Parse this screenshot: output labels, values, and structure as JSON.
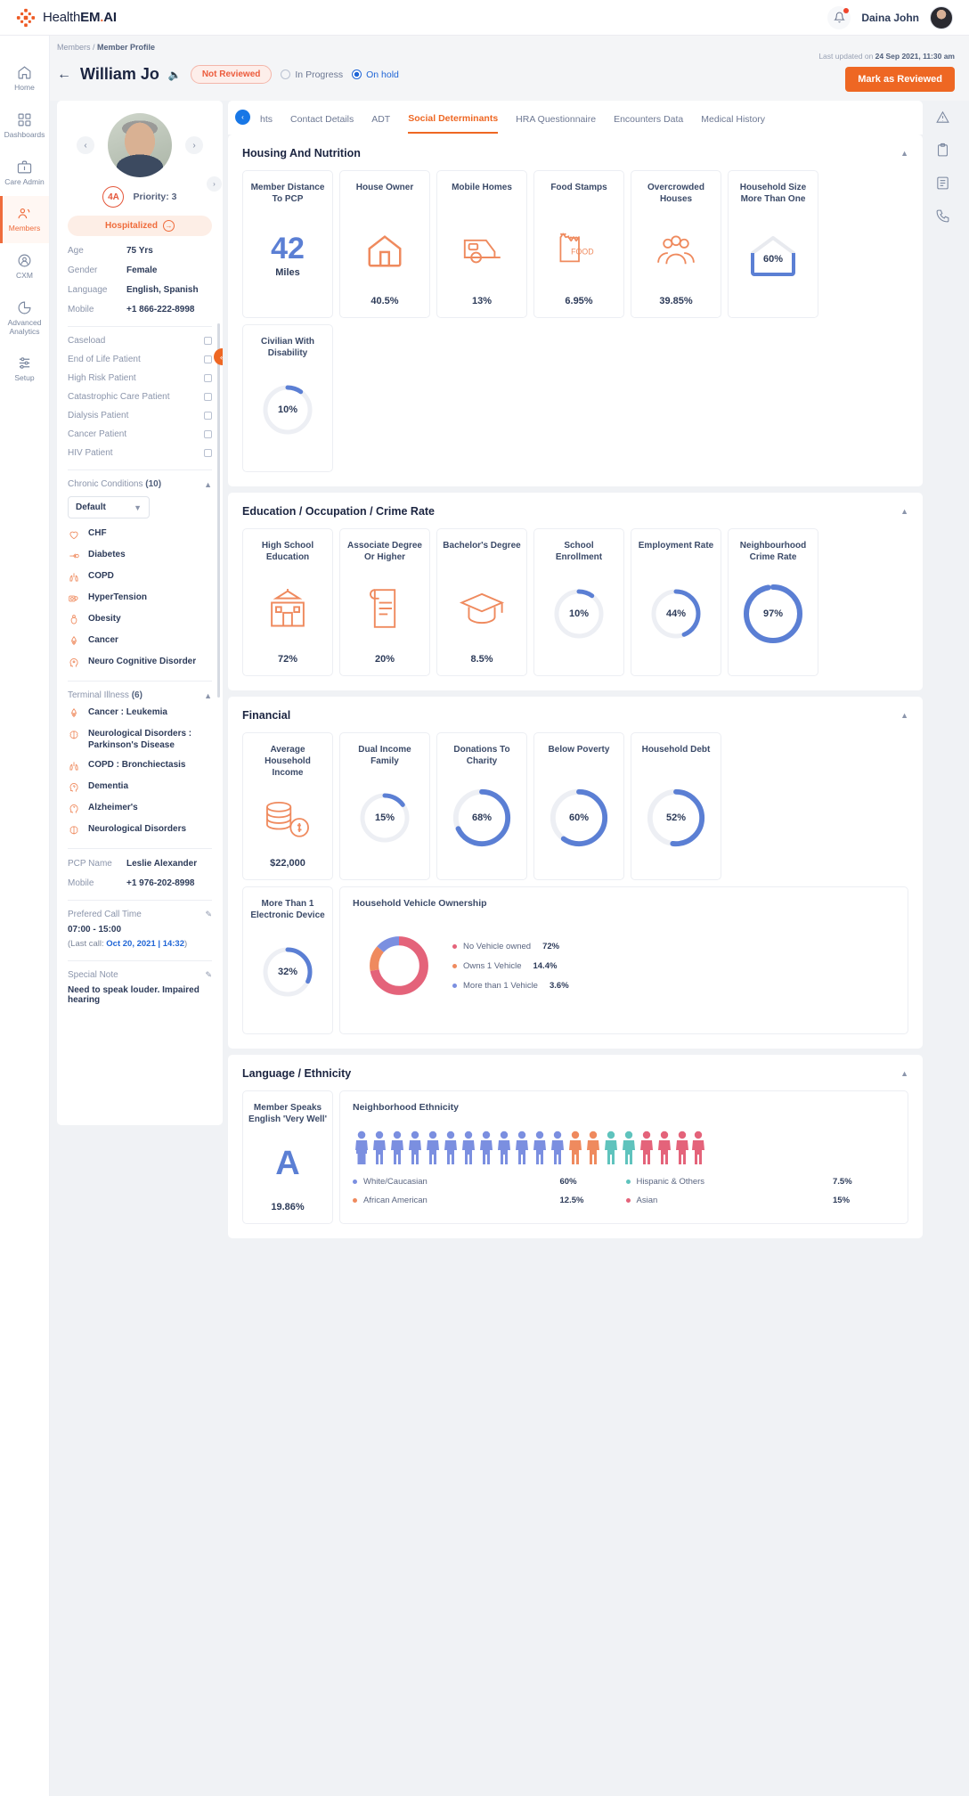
{
  "brand": {
    "prefix": "Health",
    "strong": "EM",
    "dot": ".",
    "suffix": "AI"
  },
  "topbar": {
    "user_name": "Daina John",
    "bell_icon": "bell-icon",
    "avatar": "user-avatar"
  },
  "breadcrumb": {
    "parent": "Members",
    "sep": " / ",
    "current": "Member Profile"
  },
  "header": {
    "patient_name": "William Jo",
    "status_pill": "Not Reviewed",
    "radio_in_progress": "In Progress",
    "radio_on_hold": "On hold",
    "last_updated_prefix": "Last updated on ",
    "last_updated_value": "24 Sep 2021, 11:30 am",
    "review_button": "Mark as Reviewed"
  },
  "rail": {
    "items": [
      {
        "label": "Home",
        "icon": "home-icon",
        "active": false
      },
      {
        "label": "Dashboards",
        "icon": "grid-icon",
        "active": false
      },
      {
        "label": "Care Admin",
        "icon": "briefcase-icon",
        "active": false
      },
      {
        "label": "Members",
        "icon": "members-icon",
        "active": true
      },
      {
        "label": "CXM",
        "icon": "cxm-icon",
        "active": false
      },
      {
        "label": "Advanced Analytics",
        "icon": "pie-icon",
        "active": false
      },
      {
        "label": "Setup",
        "icon": "sliders-icon",
        "active": false
      }
    ]
  },
  "right_rail": {
    "items": [
      "alert-icon",
      "clipboard-icon",
      "notes-icon",
      "phone-icon"
    ]
  },
  "patient": {
    "risk_badge": "4A",
    "priority": "Priority: 3",
    "hospitalized": "Hospitalized",
    "fields": [
      {
        "key": "Age",
        "value": "75 Yrs"
      },
      {
        "key": "Gender",
        "value": "Female"
      },
      {
        "key": "Language",
        "value": "English, Spanish"
      },
      {
        "key": "Mobile",
        "value": "+1 866-222-8998"
      }
    ],
    "flags": [
      "Caseload",
      "End of Life Patient",
      "High Risk Patient",
      "Catastrophic Care Patient",
      "Dialysis  Patient",
      "Cancer Patient",
      "HIV Patient"
    ],
    "chronic_title": "Chronic Conditions ",
    "chronic_count": "(10)",
    "chronic_select": "Default",
    "chronic_items": [
      {
        "name": "CHF",
        "icon": "heart-icon"
      },
      {
        "name": "Diabetes",
        "icon": "glucose-icon"
      },
      {
        "name": "COPD",
        "icon": "lungs-icon"
      },
      {
        "name": "HyperTension",
        "icon": "bp-monitor-icon"
      },
      {
        "name": "Obesity",
        "icon": "body-icon"
      },
      {
        "name": "Cancer",
        "icon": "ribbon-icon"
      },
      {
        "name": "Neuro Cognitive Disorder",
        "icon": "head-icon"
      }
    ],
    "terminal_title": "Terminal Illness ",
    "terminal_count": "(6)",
    "terminal_items": [
      {
        "name": "Cancer : Leukemia",
        "icon": "ribbon-icon"
      },
      {
        "name": "Neurological Disorders : Parkinson's Disease",
        "icon": "brain-icon"
      },
      {
        "name": "COPD : Bronchiectasis",
        "icon": "lungs-icon"
      },
      {
        "name": "Dementia",
        "icon": "head-question-icon"
      },
      {
        "name": "Alzheimer's",
        "icon": "head-icon"
      },
      {
        "name": "Neurological Disorders",
        "icon": "brain-icon"
      }
    ],
    "pcp": [
      {
        "key": "PCP Name",
        "value": "Leslie Alexander"
      },
      {
        "key": "Mobile",
        "value": "+1 976-202-8998"
      }
    ],
    "call_time_label": "Prefered Call Time",
    "call_time_value": "07:00 - 15:00",
    "last_call_prefix": "(Last call: ",
    "last_call_value": "Oct 20, 2021 | 14:32",
    "last_call_suffix": ")",
    "special_note_label": "Special Note",
    "special_note_value": "Need to speak louder. Impaired hearing"
  },
  "tabs": [
    {
      "label": "hts",
      "active": false
    },
    {
      "label": "Contact Details",
      "active": false
    },
    {
      "label": "ADT",
      "active": false
    },
    {
      "label": "Social Determinants",
      "active": true
    },
    {
      "label": "HRA Questionnaire",
      "active": false
    },
    {
      "label": "Encounters Data",
      "active": false
    },
    {
      "label": "Medical History",
      "active": false
    }
  ],
  "chart_data": [
    {
      "type": "bar",
      "title": "Housing And Nutrition",
      "categories": [
        "Member Distance To PCP",
        "House Owner",
        "Mobile Homes",
        "Food Stamps",
        "Overcrowded Houses",
        "Household Size More Than One",
        "Civilian With Disability"
      ],
      "values": [
        42,
        40.5,
        13,
        6.95,
        39.85,
        60,
        10
      ],
      "value_labels": [
        "42",
        "40.5%",
        "13%",
        "6.95%",
        "39.85%",
        "60%",
        "10%"
      ],
      "units": [
        "Miles",
        "%",
        "%",
        "%",
        "%",
        "%",
        "%"
      ],
      "render": [
        "number",
        "icon",
        "icon",
        "icon",
        "icon",
        "house-gauge",
        "donut"
      ],
      "icons": [
        "",
        "house-icon",
        "mobile-home-icon",
        "food-stamp-icon",
        "crowd-icon",
        "",
        ""
      ],
      "ylim": [
        0,
        100
      ]
    },
    {
      "type": "bar",
      "title": "Education / Occupation / Crime Rate",
      "categories": [
        "High School Education",
        "Associate Degree Or Higher",
        "Bachelor's Degree",
        "School Enrollment",
        "Employment Rate",
        "Neighbourhood Crime Rate"
      ],
      "values": [
        72,
        20,
        8.5,
        10,
        44,
        97
      ],
      "value_labels": [
        "72%",
        "20%",
        "8.5%",
        "10%",
        "44%",
        "97%"
      ],
      "render": [
        "icon",
        "icon",
        "icon",
        "donut",
        "donut",
        "donut"
      ],
      "icons": [
        "school-icon",
        "diploma-icon",
        "graduation-cap-icon",
        "",
        "",
        ""
      ],
      "ylim": [
        0,
        100
      ]
    },
    {
      "type": "bar",
      "title": "Financial",
      "categories": [
        "Average Household Income",
        "Dual Income Family",
        "Donations To Charity",
        "Below Poverty",
        "Household Debt",
        "More Than 1 Electronic Device"
      ],
      "values": [
        22000,
        15,
        68,
        60,
        52,
        32
      ],
      "value_labels": [
        "$22,000",
        "15%",
        "68%",
        "60%",
        "52%",
        "32%"
      ],
      "render": [
        "icon",
        "donut",
        "donut",
        "donut",
        "donut",
        "donut"
      ],
      "icons": [
        "money-stack-icon",
        "",
        "",
        "",
        "",
        ""
      ],
      "ylim": [
        0,
        100
      ]
    },
    {
      "type": "pie",
      "title": "Household Vehicle Ownership",
      "labels": [
        "No Vehicle owned",
        "Owns 1 Vehicle",
        "More than 1 Vehicle"
      ],
      "values": [
        72,
        14.4,
        3.6
      ],
      "value_labels": [
        "72%",
        "14.4%",
        "3.6%"
      ],
      "colors": [
        "#e4637a",
        "#ef8a5e",
        "#7b8fe0"
      ],
      "legend": "right"
    },
    {
      "type": "bar",
      "title": "Neighborhood Ethnicity",
      "categories": [
        "White/Caucasian",
        "African American",
        "Hispanic & Others",
        "Asian"
      ],
      "values": [
        60,
        12.5,
        7.5,
        15
      ],
      "value_labels": [
        "60%",
        "12.5%",
        "7.5%",
        "15%"
      ],
      "colors": [
        "#7b8fe0",
        "#ef8a5e",
        "#5fc3bd",
        "#e4637a"
      ],
      "pictogram_total": 20
    },
    {
      "type": "bar",
      "title": "Member Speaks English 'Very Well'",
      "categories": [
        "Member Speaks English 'Very Well'"
      ],
      "values": [
        19.86
      ],
      "value_labels": [
        "19.86%"
      ]
    }
  ],
  "sections": {
    "housing": {
      "title": "Housing And Nutrition",
      "cards": [
        {
          "title": "Member Distance To PCP",
          "value": "42",
          "unit": "Miles",
          "render": "number",
          "icon": ""
        },
        {
          "title": "House Owner",
          "value": "40.5%",
          "render": "icon",
          "icon": "house-icon"
        },
        {
          "title": "Mobile Homes",
          "value": "13%",
          "render": "icon",
          "icon": "mobile-home-icon"
        },
        {
          "title": "Food Stamps",
          "value": "6.95%",
          "render": "icon",
          "icon": "food-stamp-icon"
        },
        {
          "title": "Overcrowded Houses",
          "value": "39.85%",
          "render": "icon",
          "icon": "crowd-icon"
        },
        {
          "title": "Household Size More Than One",
          "value": "60%",
          "render": "house-gauge",
          "pct": 60
        },
        {
          "title": "Civilian With Disability",
          "value": "10%",
          "render": "donut",
          "pct": 10
        }
      ]
    },
    "education": {
      "title": "Education / Occupation / Crime Rate",
      "cards": [
        {
          "title": "High School Education",
          "value": "72%",
          "render": "icon",
          "icon": "school-icon"
        },
        {
          "title": "Associate Degree Or Higher",
          "value": "20%",
          "render": "icon",
          "icon": "diploma-icon"
        },
        {
          "title": "Bachelor's Degree",
          "value": "8.5%",
          "render": "icon",
          "icon": "graduation-cap-icon"
        },
        {
          "title": "School Enrollment",
          "value": "10%",
          "render": "donut",
          "pct": 10
        },
        {
          "title": "Employment Rate",
          "value": "44%",
          "render": "donut",
          "pct": 44
        },
        {
          "title": "Neighbourhood Crime Rate",
          "value": "97%",
          "render": "donut",
          "pct": 97
        }
      ]
    },
    "financial": {
      "title": "Financial",
      "cards": [
        {
          "title": "Average Household Income",
          "value": "$22,000",
          "render": "icon",
          "icon": "money-stack-icon"
        },
        {
          "title": "Dual Income Family",
          "value": "15%",
          "render": "donut",
          "pct": 15
        },
        {
          "title": "Donations To Charity",
          "value": "68%",
          "render": "donut",
          "pct": 68
        },
        {
          "title": "Below Poverty",
          "value": "60%",
          "render": "donut",
          "pct": 60
        },
        {
          "title": "Household Debt",
          "value": "52%",
          "render": "donut",
          "pct": 52
        },
        {
          "title": "More Than 1 Electronic Device",
          "value": "32%",
          "render": "donut",
          "pct": 32
        }
      ],
      "vehicle": {
        "title": "Household Vehicle Ownership",
        "legend": [
          {
            "label": "No Vehicle owned",
            "value": "72%",
            "color": "#e4637a"
          },
          {
            "label": "Owns 1 Vehicle",
            "value": "14.4%",
            "color": "#ef8a5e"
          },
          {
            "label": "More than 1 Vehicle",
            "value": "3.6%",
            "color": "#7b8fe0"
          }
        ]
      }
    },
    "language": {
      "title": "Language / Ethnicity",
      "speaks_card": {
        "title": "Member Speaks English 'Very Well'",
        "letter": "A",
        "value": "19.86%"
      },
      "ethnicity": {
        "title": "Neighborhood Ethnicity",
        "legend": [
          {
            "label": "White/Caucasian",
            "value": "60%",
            "color": "#7b8fe0"
          },
          {
            "label": "Hispanic & Others",
            "value": "7.5%",
            "color": "#5fc3bd"
          },
          {
            "label": "African American",
            "value": "12.5%",
            "color": "#ef8a5e"
          },
          {
            "label": "Asian",
            "value": "15%",
            "color": "#e4637a"
          }
        ]
      }
    }
  },
  "colors": {
    "accent": "#ee6723",
    "blue": "#5b7fd4",
    "dark": "#1b2440",
    "muted": "#8b95ab"
  }
}
